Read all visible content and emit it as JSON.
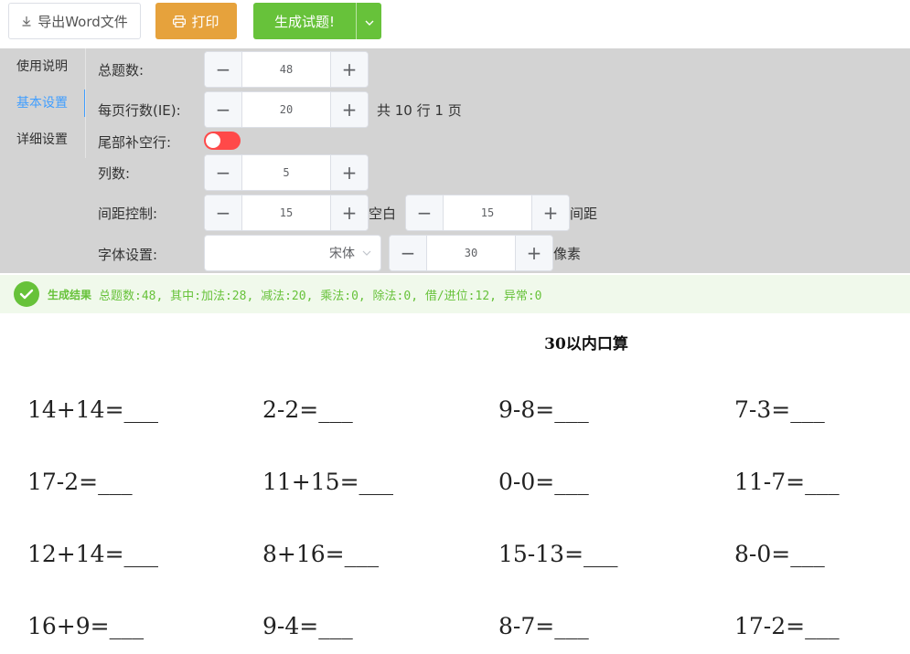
{
  "toolbar": {
    "export_label": "导出Word文件",
    "print_label": "打印",
    "generate_label": "生成试题!"
  },
  "tabs": [
    "使用说明",
    "基本设置",
    "详细设置"
  ],
  "settings": {
    "total_label": "总题数:",
    "total_value": "48",
    "rows_label": "每页行数(IE):",
    "rows_value": "20",
    "pages_text": "共 10 行 1 页",
    "pad_label": "尾部补空行:",
    "pad_enabled": false,
    "cols_label": "列数:",
    "cols_value": "5",
    "spacing_label": "间距控制:",
    "spacing_value1": "15",
    "spacing_text1": "空白",
    "spacing_value2": "15",
    "spacing_text2": "间距",
    "font_label": "字体设置:",
    "font_value": "宋体",
    "font_size_value": "30",
    "font_unit": "像素"
  },
  "result": {
    "title": "生成结果",
    "desc": "总题数:48, 其中:加法:28, 减法:20, 乘法:0, 除法:0, 借/进位:12, 异常:0"
  },
  "worksheet": {
    "title": "30以内口算",
    "rows": [
      [
        "14+14=___",
        "2-2=___",
        "9-8=___",
        "7-3=___"
      ],
      [
        "17-2=___",
        "11+15=___",
        "0-0=___",
        "11-7=___"
      ],
      [
        "12+14=___",
        "8+16=___",
        "15-13=___",
        "8-0=___"
      ],
      [
        "16+9=___",
        "9-4=___",
        "8-7=___",
        "17-2=___"
      ]
    ]
  },
  "colors": {
    "print": "#e6a23c",
    "generate": "#67c23a",
    "active_tab": "#409eff",
    "toggle_off": "#ff4949",
    "panel_bg": "#d3d3d3",
    "result_bg": "#f0f9eb"
  }
}
